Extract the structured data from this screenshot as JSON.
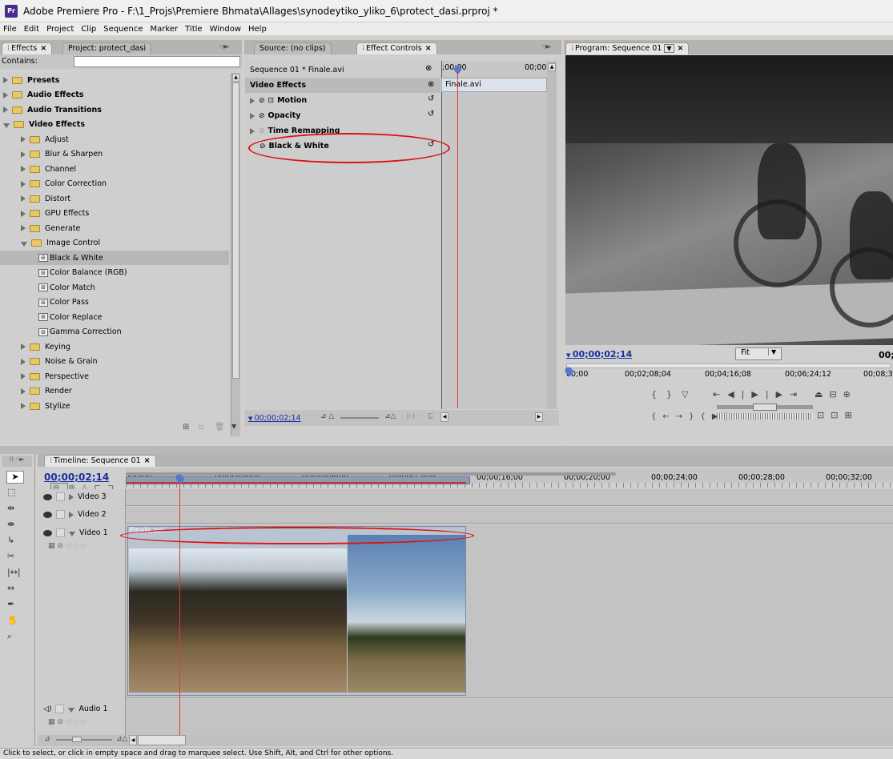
{
  "window": {
    "title": "Adobe Premiere Pro - F:\\1_Projs\\Premiere Bhmata\\Allages\\synodeytiko_yliko_6\\protect_dasi.prproj *",
    "app_icon": "Pr"
  },
  "menu": [
    "File",
    "Edit",
    "Project",
    "Clip",
    "Sequence",
    "Marker",
    "Title",
    "Window",
    "Help"
  ],
  "effects_panel": {
    "tab_effects": "Effects",
    "tab_project": "Project: protect_dasi",
    "contains_label": "Contains:",
    "search_value": "",
    "tree": [
      {
        "label": "Presets",
        "level": 0,
        "kind": "folder-bold",
        "open": false
      },
      {
        "label": "Audio Effects",
        "level": 0,
        "kind": "folder-bold",
        "open": false
      },
      {
        "label": "Audio Transitions",
        "level": 0,
        "kind": "folder-bold",
        "open": false
      },
      {
        "label": "Video Effects",
        "level": 0,
        "kind": "folder-bold",
        "open": true
      },
      {
        "label": "Adjust",
        "level": 1,
        "kind": "folder",
        "open": false
      },
      {
        "label": "Blur & Sharpen",
        "level": 1,
        "kind": "folder",
        "open": false
      },
      {
        "label": "Channel",
        "level": 1,
        "kind": "folder",
        "open": false
      },
      {
        "label": "Color Correction",
        "level": 1,
        "kind": "folder",
        "open": false
      },
      {
        "label": "Distort",
        "level": 1,
        "kind": "folder",
        "open": false
      },
      {
        "label": "GPU Effects",
        "level": 1,
        "kind": "folder",
        "open": false
      },
      {
        "label": "Generate",
        "level": 1,
        "kind": "folder",
        "open": false
      },
      {
        "label": "Image Control",
        "level": 1,
        "kind": "folder",
        "open": true
      },
      {
        "label": "Black & White",
        "level": 2,
        "kind": "effect",
        "selected": true
      },
      {
        "label": "Color Balance (RGB)",
        "level": 2,
        "kind": "effect"
      },
      {
        "label": "Color Match",
        "level": 2,
        "kind": "effect"
      },
      {
        "label": "Color Pass",
        "level": 2,
        "kind": "effect"
      },
      {
        "label": "Color Replace",
        "level": 2,
        "kind": "effect"
      },
      {
        "label": "Gamma Correction",
        "level": 2,
        "kind": "effect"
      },
      {
        "label": "Keying",
        "level": 1,
        "kind": "folder",
        "open": false
      },
      {
        "label": "Noise & Grain",
        "level": 1,
        "kind": "folder",
        "open": false
      },
      {
        "label": "Perspective",
        "level": 1,
        "kind": "folder",
        "open": false
      },
      {
        "label": "Render",
        "level": 1,
        "kind": "folder",
        "open": false
      },
      {
        "label": "Stylize",
        "level": 1,
        "kind": "folder",
        "open": false
      }
    ]
  },
  "effect_controls": {
    "tab_source": "Source: (no clips)",
    "tab_effect_controls": "Effect Controls",
    "sequence_label": "Sequence 01 * Finale.avi",
    "ruler_start": ";00;00",
    "ruler_end": "00;00",
    "clip_name": "Finale.avi",
    "section_label": "Video Effects",
    "effects": [
      {
        "label": "Motion",
        "icon": "motion-icon"
      },
      {
        "label": "Opacity"
      },
      {
        "label": "Time Remapping"
      },
      {
        "label": "Black & White"
      }
    ],
    "timecode": "00;00;02;14"
  },
  "program_monitor": {
    "tab": "Program: Sequence 01",
    "timecode": "00;00;02;14",
    "fit": "Fit",
    "right_timecode": "00;",
    "ruler": [
      "00;00",
      "00;02;08;04",
      "00;04;16;08",
      "00;06;24;12",
      "00;08;3"
    ]
  },
  "timeline": {
    "tab": "Timeline: Sequence 01",
    "timecode": "00;00;02;14",
    "ruler": ";00;00|00;00;04;00|00;00;08;00|00;00;12;00|00;00;16;00|00;00;20;00|00;00;24;00|00;00;28;00|00;00;32;00|00",
    "tracks": {
      "video3": "Video 3",
      "video2": "Video 2",
      "video1": "Video 1",
      "audio1": "Audio 1"
    },
    "clip_label": "Finale.avi"
  },
  "status_bar": "Click to select, or click in empty space and drag to marquee select. Use Shift, Alt, and Ctrl for other options.",
  "colors": {
    "annotation_red": "#e01010",
    "timecode_blue": "#1a2ea0",
    "playhead": "#e03a3a"
  }
}
